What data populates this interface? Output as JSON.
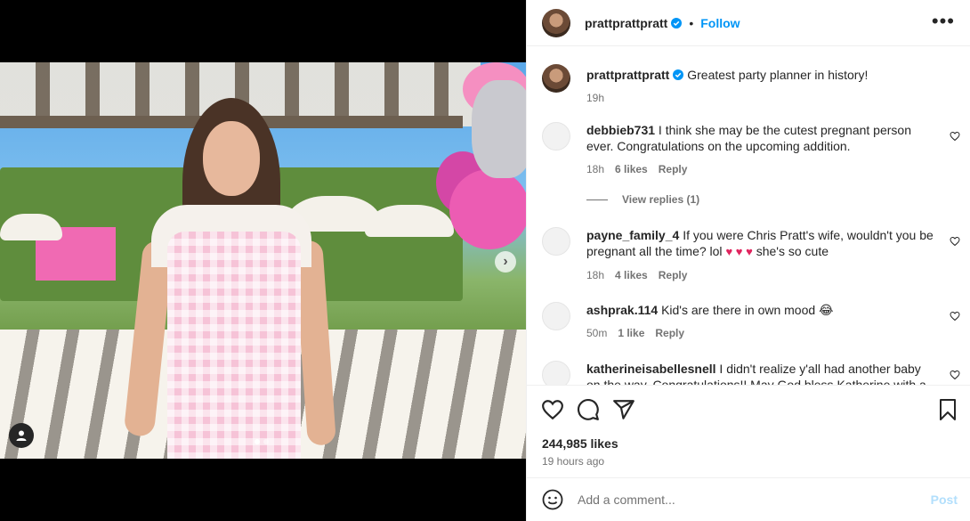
{
  "header": {
    "username": "prattprattpratt",
    "separator": "•",
    "follow_label": "Follow",
    "more_icon": "more-horizontal-icon"
  },
  "caption": {
    "username": "prattprattpratt",
    "text": "Greatest party planner in history!",
    "time": "19h"
  },
  "comments": [
    {
      "username": "debbieb731",
      "text": "I think she may be the cutest pregnant person ever. Congratulations on the upcoming addition.",
      "time": "18h",
      "likes": "6 likes",
      "reply": "Reply"
    },
    {
      "username": "payne_family_4",
      "text_before": "If you were Chris Pratt's wife, wouldn't you be pregnant all the time? lol",
      "hearts": "♥ ♥ ♥",
      "text_after": "she's so cute",
      "time": "18h",
      "likes": "4 likes",
      "reply": "Reply"
    },
    {
      "username": "ashprak.114",
      "text": "Kid's are there in own mood",
      "emoji": "😂",
      "time": "50m",
      "likes": "1 like",
      "reply": "Reply"
    },
    {
      "username": "katherineisabellesnell",
      "text": "I didn't realize y'all had another baby on the way. Congratulations!! May God bless Katherine with a safe"
    }
  ],
  "view_replies": "View replies (1)",
  "actions": {
    "likes": "244,985 likes",
    "time": "19 hours ago"
  },
  "add_comment": {
    "placeholder": "Add a comment...",
    "post_label": "Post"
  },
  "colors": {
    "accent": "#0095f6",
    "post_disabled": "#b2dffc",
    "muted": "#737373"
  }
}
